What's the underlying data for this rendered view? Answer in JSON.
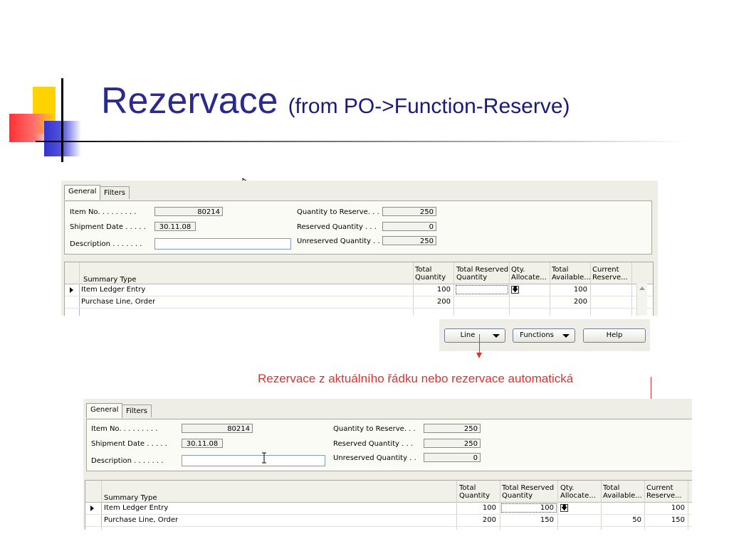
{
  "slide": {
    "title_main": "Rezervace",
    "title_sub": "(from PO->Function-Reserve)",
    "annotation": "Rezervace z aktuálního řádku nebo rezervace automatická",
    "colors": {
      "title": "#2a2a8c",
      "annotation": "#e03030",
      "form_bg": "#eeeee6"
    }
  },
  "form_before": {
    "tabs": [
      "General",
      "Filters"
    ],
    "item_no_label": "Item No. . . . . . . . .",
    "item_no": "80214",
    "shipment_date_label": "Shipment Date . . . . .",
    "shipment_date": "30.11.08",
    "description_label": "Description . . . . . . .",
    "description": "",
    "qty_to_reserve_label": "Quantity to Reserve. . .",
    "qty_to_reserve": "250",
    "reserved_qty_label": "Reserved Quantity . . .",
    "reserved_qty": "0",
    "unreserved_qty_label": "Unreserved Quantity . .",
    "unreserved_qty": "250",
    "columns": {
      "summary_type": "Summary Type",
      "total_qty_1": "Total",
      "total_qty_2": "Quantity",
      "total_reserved_1": "Total Reserved",
      "total_reserved_2": "Quantity",
      "qty_alloc_1": "Qty.",
      "qty_alloc_2": "Allocate...",
      "total_avail_1": "Total",
      "total_avail_2": "Available...",
      "current_res_1": "Current",
      "current_res_2": "Reserve..."
    },
    "rows": [
      {
        "summary_type": "Item Ledger Entry",
        "total_qty": "100",
        "total_reserved": "",
        "qty_alloc": "",
        "total_avail": "100",
        "current_res": ""
      },
      {
        "summary_type": "Purchase Line, Order",
        "total_qty": "200",
        "total_reserved": "",
        "qty_alloc": "",
        "total_avail": "200",
        "current_res": ""
      }
    ]
  },
  "buttons": {
    "line": "Line",
    "functions": "Functions",
    "help": "Help"
  },
  "form_after": {
    "tabs": [
      "General",
      "Filters"
    ],
    "item_no_label": "Item No. . . . . . . . .",
    "item_no": "80214",
    "shipment_date_label": "Shipment Date . . . . .",
    "shipment_date": "30.11.08",
    "description_label": "Description . . . . . . .",
    "description": "",
    "qty_to_reserve_label": "Quantity to Reserve. . .",
    "qty_to_reserve": "250",
    "reserved_qty_label": "Reserved Quantity . . .",
    "reserved_qty": "250",
    "unreserved_qty_label": "Unreserved Quantity . .",
    "unreserved_qty": "0",
    "columns": {
      "summary_type": "Summary Type",
      "total_qty_1": "Total",
      "total_qty_2": "Quantity",
      "total_reserved_1": "Total Reserved",
      "total_reserved_2": "Quantity",
      "qty_alloc_1": "Qty.",
      "qty_alloc_2": "Allocate...",
      "total_avail_1": "Total",
      "total_avail_2": "Available...",
      "current_res_1": "Current",
      "current_res_2": "Reserve..."
    },
    "rows": [
      {
        "summary_type": "Item Ledger Entry",
        "total_qty": "100",
        "total_reserved": "100",
        "qty_alloc": "",
        "total_avail": "",
        "current_res": "100"
      },
      {
        "summary_type": "Purchase Line, Order",
        "total_qty": "200",
        "total_reserved": "150",
        "qty_alloc": "",
        "total_avail": "50",
        "current_res": "150"
      }
    ]
  },
  "icons": [
    "mouse-pointer-icon",
    "text-cursor-icon",
    "lookup-arrow-icon",
    "row-pointer-icon",
    "dropdown-arrow-icon",
    "scroll-up-icon"
  ]
}
